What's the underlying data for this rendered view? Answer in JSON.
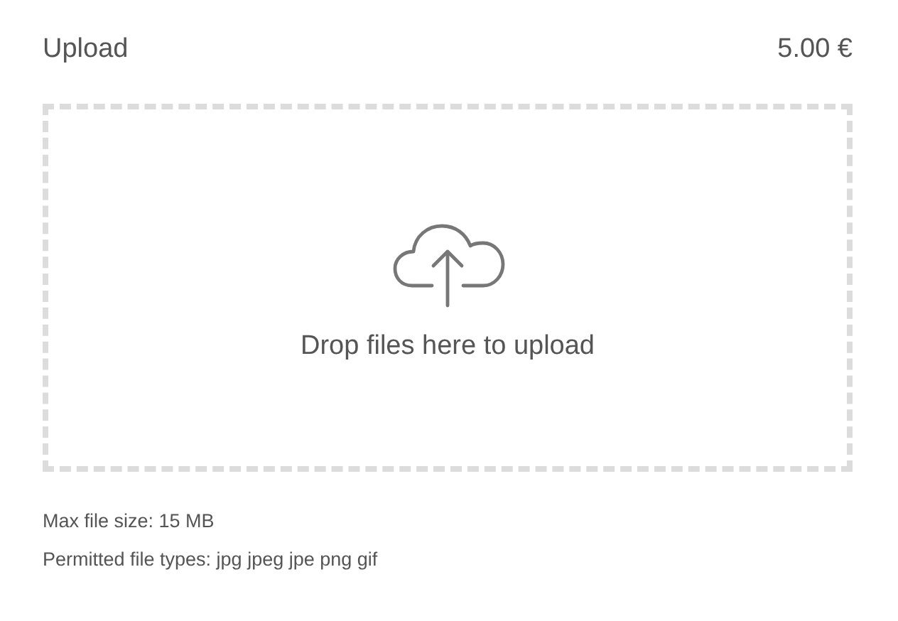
{
  "header": {
    "title": "Upload",
    "price": "5.00 €"
  },
  "dropzone": {
    "message": "Drop files here to upload"
  },
  "notes": [
    "Max file size: 15 MB",
    "Permitted file types: jpg jpeg jpe png gif"
  ]
}
